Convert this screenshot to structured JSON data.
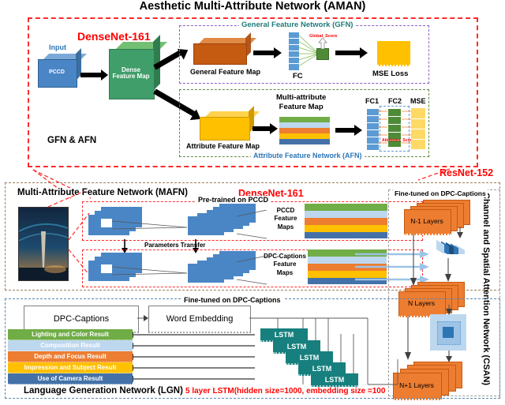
{
  "title": "Aesthetic Multi-Attribute Network (AMAN)",
  "aman": {
    "densenet_label": "DenseNet-161",
    "input_label": "Input",
    "input_box": "PCCD",
    "dense_box": "Dense\nFeature Map",
    "section_label": "GFN & AFN",
    "gfn": {
      "title": "General Feature Network (GFN)",
      "feature_map": "General Feature Map",
      "fc": "FC",
      "global_score": "Global_Score",
      "mse": "MSE Loss"
    },
    "afn": {
      "title": "Attribute Feature Network (AFN)",
      "attr_map": "Attribute Feature Map",
      "multi_attr": "Multi-attribute\nFeature Map",
      "fc1": "FC1",
      "fc2": "FC2",
      "mse": "MSE",
      "attr_scores": "Attributes_Scores"
    }
  },
  "mafn": {
    "title": "Multi-Attribute Feature Network (MAFN)",
    "densenet_label": "DenseNet-161",
    "pretrained": "Pre-trained on PCCD",
    "pccd_feature_maps": "PCCD\nFeature\nMaps",
    "params_transfer": "Parameters Transfer",
    "dpc_feature_maps": "DPC-Captions\nFeature\nMaps"
  },
  "csan": {
    "resnet_label": "ResNet-152",
    "title": "Channel and Spatial Attention Network (CSAN)",
    "finetuned": "Fine-tuned on DPC-Captions",
    "n_minus_1": "N-1 Layers",
    "n_layers": "N  Layers",
    "n_plus_1": "N+1 Layers"
  },
  "lgn": {
    "title": "Language Generation Network (LGN)",
    "finetuned": "Fine-tuned on DPC-Captions",
    "captions_box": "DPC-Captions",
    "word_embedding": "Word Embedding",
    "lstm_label": "LSTM",
    "lstm_count": 5,
    "note": "5 layer LSTM(hidden size=1000, embedding size =100",
    "results": [
      {
        "label": "Lighting and Color Result",
        "color": "#70ad47"
      },
      {
        "label": "Composition Result",
        "color": "#bdd7ee"
      },
      {
        "label": "Depth and Focus Result",
        "color": "#ed7d31"
      },
      {
        "label": "Impression and Subject Result",
        "color": "#ffc000"
      },
      {
        "label": "Use of Camera Result",
        "color": "#4472a8"
      }
    ]
  },
  "colors": {
    "red": "#ff2a2a",
    "purple": "#8e5ec8",
    "green_dash": "#5f8a3f",
    "brown_dash": "#9c7c5b",
    "blue_dash": "#5b84b1",
    "orange": "#ed7d31",
    "green": "#3f9e6a",
    "yellow": "#ffc000",
    "teal": "#17807e",
    "blue": "#5b9bd5"
  },
  "feature_stripes": [
    "#70ad47",
    "#bdd7ee",
    "#ed7d31",
    "#ffc000",
    "#4472a8"
  ]
}
